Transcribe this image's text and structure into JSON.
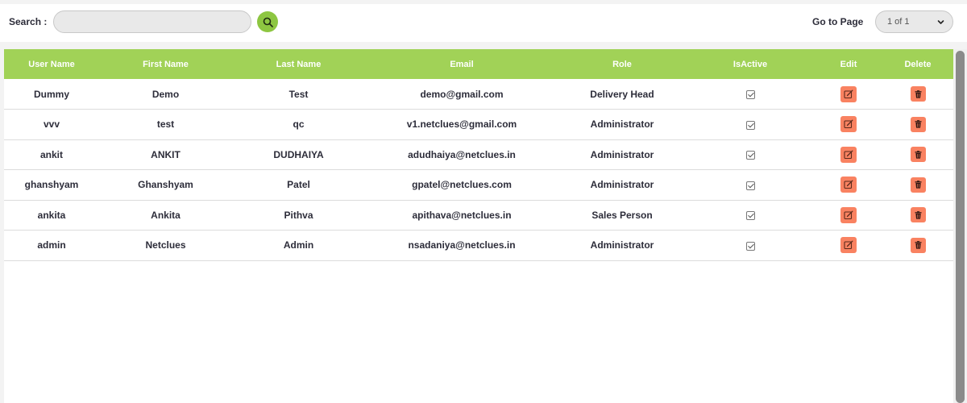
{
  "toolbar": {
    "search_label": "Search :",
    "search_value": "",
    "search_placeholder": "",
    "goto_label": "Go to Page",
    "page_select_value": "1 of 1"
  },
  "table": {
    "columns": [
      "User Name",
      "First Name",
      "Last Name",
      "Email",
      "Role",
      "IsActive",
      "Edit",
      "Delete"
    ],
    "rows": [
      {
        "username": "Dummy",
        "first": "Demo",
        "last": "Test",
        "email": "demo@gmail.com",
        "role": "Delivery Head",
        "active": true
      },
      {
        "username": "vvv",
        "first": "test",
        "last": "qc",
        "email": "v1.netclues@gmail.com",
        "role": "Administrator",
        "active": true
      },
      {
        "username": "ankit",
        "first": "ANKIT",
        "last": "DUDHAIYA",
        "email": "adudhaiya@netclues.in",
        "role": "Administrator",
        "active": true
      },
      {
        "username": "ghanshyam",
        "first": "Ghanshyam",
        "last": "Patel",
        "email": "gpatel@netclues.com",
        "role": "Administrator",
        "active": true
      },
      {
        "username": "ankita",
        "first": "Ankita",
        "last": "Pithva",
        "email": "apithava@netclues.in",
        "role": "Sales Person",
        "active": true
      },
      {
        "username": "admin",
        "first": "Netclues",
        "last": "Admin",
        "email": "nsadaniya@netclues.in",
        "role": "Administrator",
        "active": true
      }
    ]
  },
  "icons": {
    "search": "search-icon",
    "chevron": "chevron-down-icon",
    "edit": "edit-icon",
    "delete": "trash-icon"
  },
  "colors": {
    "accent_green": "#8dc641",
    "header_green": "#a1d257",
    "action_orange": "#f98261"
  }
}
